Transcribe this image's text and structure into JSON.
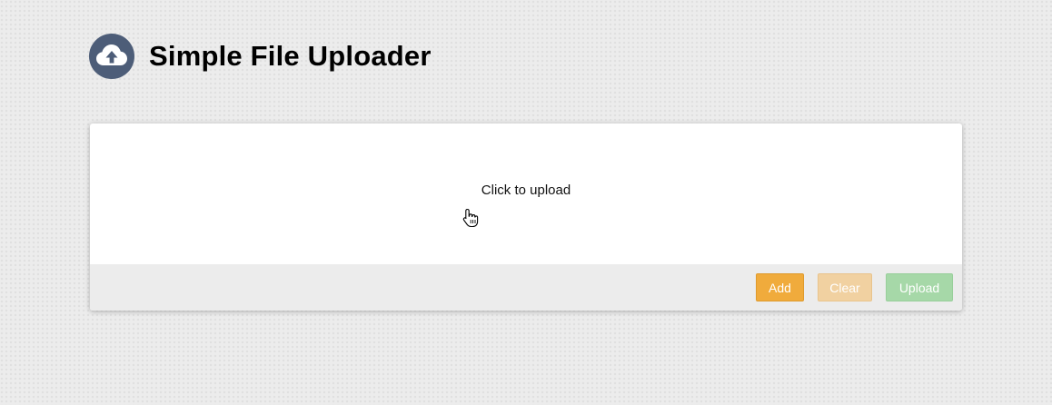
{
  "header": {
    "logo_icon": "cloud-upload-icon",
    "title": "Simple File Uploader"
  },
  "uploader": {
    "dropzone_text": "Click to upload",
    "buttons": {
      "add": "Add",
      "clear": "Clear",
      "upload": "Upload"
    },
    "button_states": {
      "add": "enabled",
      "clear": "disabled",
      "upload": "disabled"
    }
  },
  "colors": {
    "logo": "#4d5d78",
    "add": "#f0ab3c",
    "clear_disabled": "#f1d1a1",
    "upload_disabled": "#a6d8a8",
    "footer": "#ececec"
  }
}
